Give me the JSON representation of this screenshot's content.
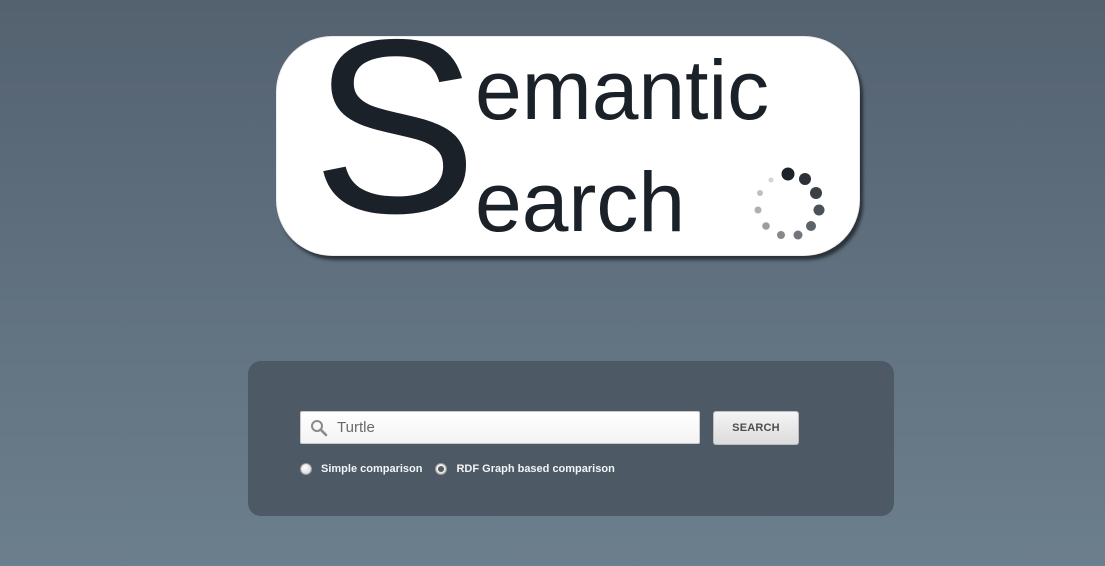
{
  "logo": {
    "big_letter": "S",
    "line1": "emantic",
    "line2": "earch",
    "icon": "loading-spinner-icon"
  },
  "search": {
    "value": "Turtle",
    "icon": "search-icon",
    "button_label": "SEARCH"
  },
  "comparison_options": [
    {
      "label": "Simple comparison",
      "selected": false
    },
    {
      "label": "RDF Graph based comparison",
      "selected": true
    }
  ],
  "colors": {
    "logo_text": "#1b2128",
    "panel": "#4d5a66",
    "background_top": "#546270",
    "background_bottom": "#6c7f8d"
  }
}
